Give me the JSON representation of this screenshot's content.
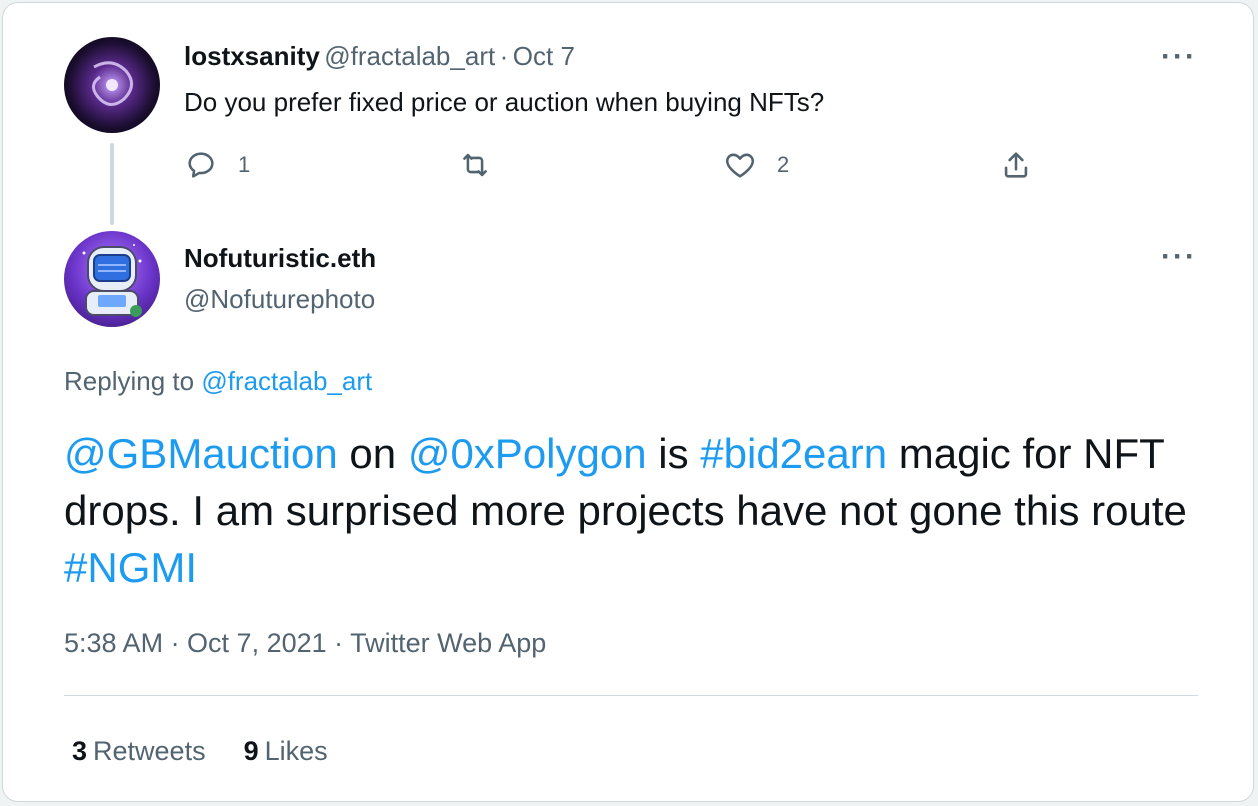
{
  "parent_tweet": {
    "display_name": "lostxsanity",
    "handle": "@fractalab_art",
    "separator": "·",
    "date": "Oct 7",
    "text": "Do you prefer fixed price or auction when buying NFTs?",
    "reply_count": "1",
    "retweet_count": "",
    "like_count": "2",
    "more_label": "···"
  },
  "main_tweet": {
    "display_name": "Nofuturistic.eth",
    "handle": "@Nofuturephoto",
    "more_label": "···",
    "replying_prefix": "Replying to",
    "replying_handle": "@fractalab_art",
    "body": {
      "mention1": "@GBMauction",
      "word_on": " on ",
      "mention2": "@0xPolygon",
      "word_is": " is ",
      "hashtag1": "#bid2earn",
      "text_rest": " magic for NFT drops. I am surprised more projects have not gone this route ",
      "hashtag2": "#NGMI"
    },
    "timestamp": "5:38 AM · Oct 7, 2021 · Twitter Web App",
    "retweets_count": "3",
    "retweets_label": "Retweets",
    "likes_count": "9",
    "likes_label": "Likes"
  },
  "colors": {
    "link": "#1d9bf0",
    "secondary_text": "#536471",
    "primary_text": "#0f1419",
    "border": "#cfd9de"
  }
}
